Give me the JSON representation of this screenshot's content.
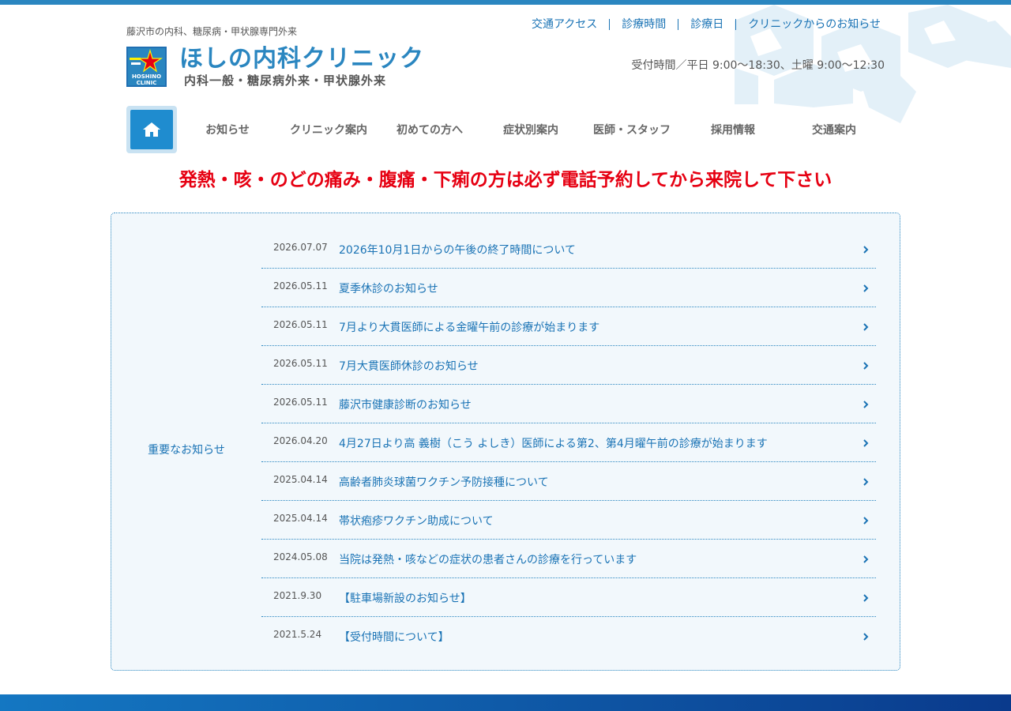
{
  "header": {
    "tagline": "藤沢市の内科、糖尿病・甲状腺専門外来",
    "clinic_name": "ほしの内科クリニック",
    "clinic_sub": "内科一般・糖尿病外来・甲状腺外来",
    "badge_text_1": "HOSHINO",
    "badge_text_2": "CLINIC",
    "hours": "受付時間／平日 9:00〜18:30、土曜 9:00〜12:30"
  },
  "util_nav": [
    {
      "label": "交通アクセス"
    },
    {
      "label": "診療時間"
    },
    {
      "label": "診療日"
    },
    {
      "label": "クリニックからのお知らせ"
    }
  ],
  "main_nav": {
    "home_icon": "home-icon",
    "items": [
      {
        "label": "お知らせ"
      },
      {
        "label": "クリニック案内"
      },
      {
        "label": "初めての方へ"
      },
      {
        "label": "症状別案内"
      },
      {
        "label": "医師・スタッフ"
      },
      {
        "label": "採用情報"
      },
      {
        "label": "交通案内"
      }
    ]
  },
  "alert": {
    "text": "発熱・咳・のどの痛み・腹痛・下痢の方は必ず電話予約してから来院して下さい",
    "color": "#e60012"
  },
  "news": {
    "label": "重要なお知らせ",
    "items": [
      {
        "date": "2026.07.07",
        "title": "2026年10月1日からの午後の終了時間について"
      },
      {
        "date": "2026.05.11",
        "title": "夏季休診のお知らせ"
      },
      {
        "date": "2026.05.11",
        "title": "7月より大貫医師による金曜午前の診療が始まります"
      },
      {
        "date": "2026.05.11",
        "title": "7月大貫医師休診のお知らせ"
      },
      {
        "date": "2026.05.11",
        "title": "藤沢市健康診断のお知らせ"
      },
      {
        "date": "2026.04.20",
        "title": "4月27日より高 義樹（こう よしき）医師による第2、第4月曜午前の診療が始まります"
      },
      {
        "date": "2025.04.14",
        "title": "高齢者肺炎球菌ワクチン予防接種について"
      },
      {
        "date": "2025.04.14",
        "title": "帯状疱疹ワクチン助成について"
      },
      {
        "date": "2024.05.08",
        "title": "当院は発熱・咳などの症状の患者さんの診療を行っています"
      },
      {
        "date": "2021.9.30",
        "title": "【駐車場新設のお知らせ】"
      },
      {
        "date": "2021.5.24",
        "title": "【受付時間について】"
      }
    ]
  },
  "colors": {
    "brand_blue": "#2a86c0",
    "link_blue": "#1a73b5",
    "alert_red": "#e60012",
    "news_bg": "#f2f8fc"
  }
}
